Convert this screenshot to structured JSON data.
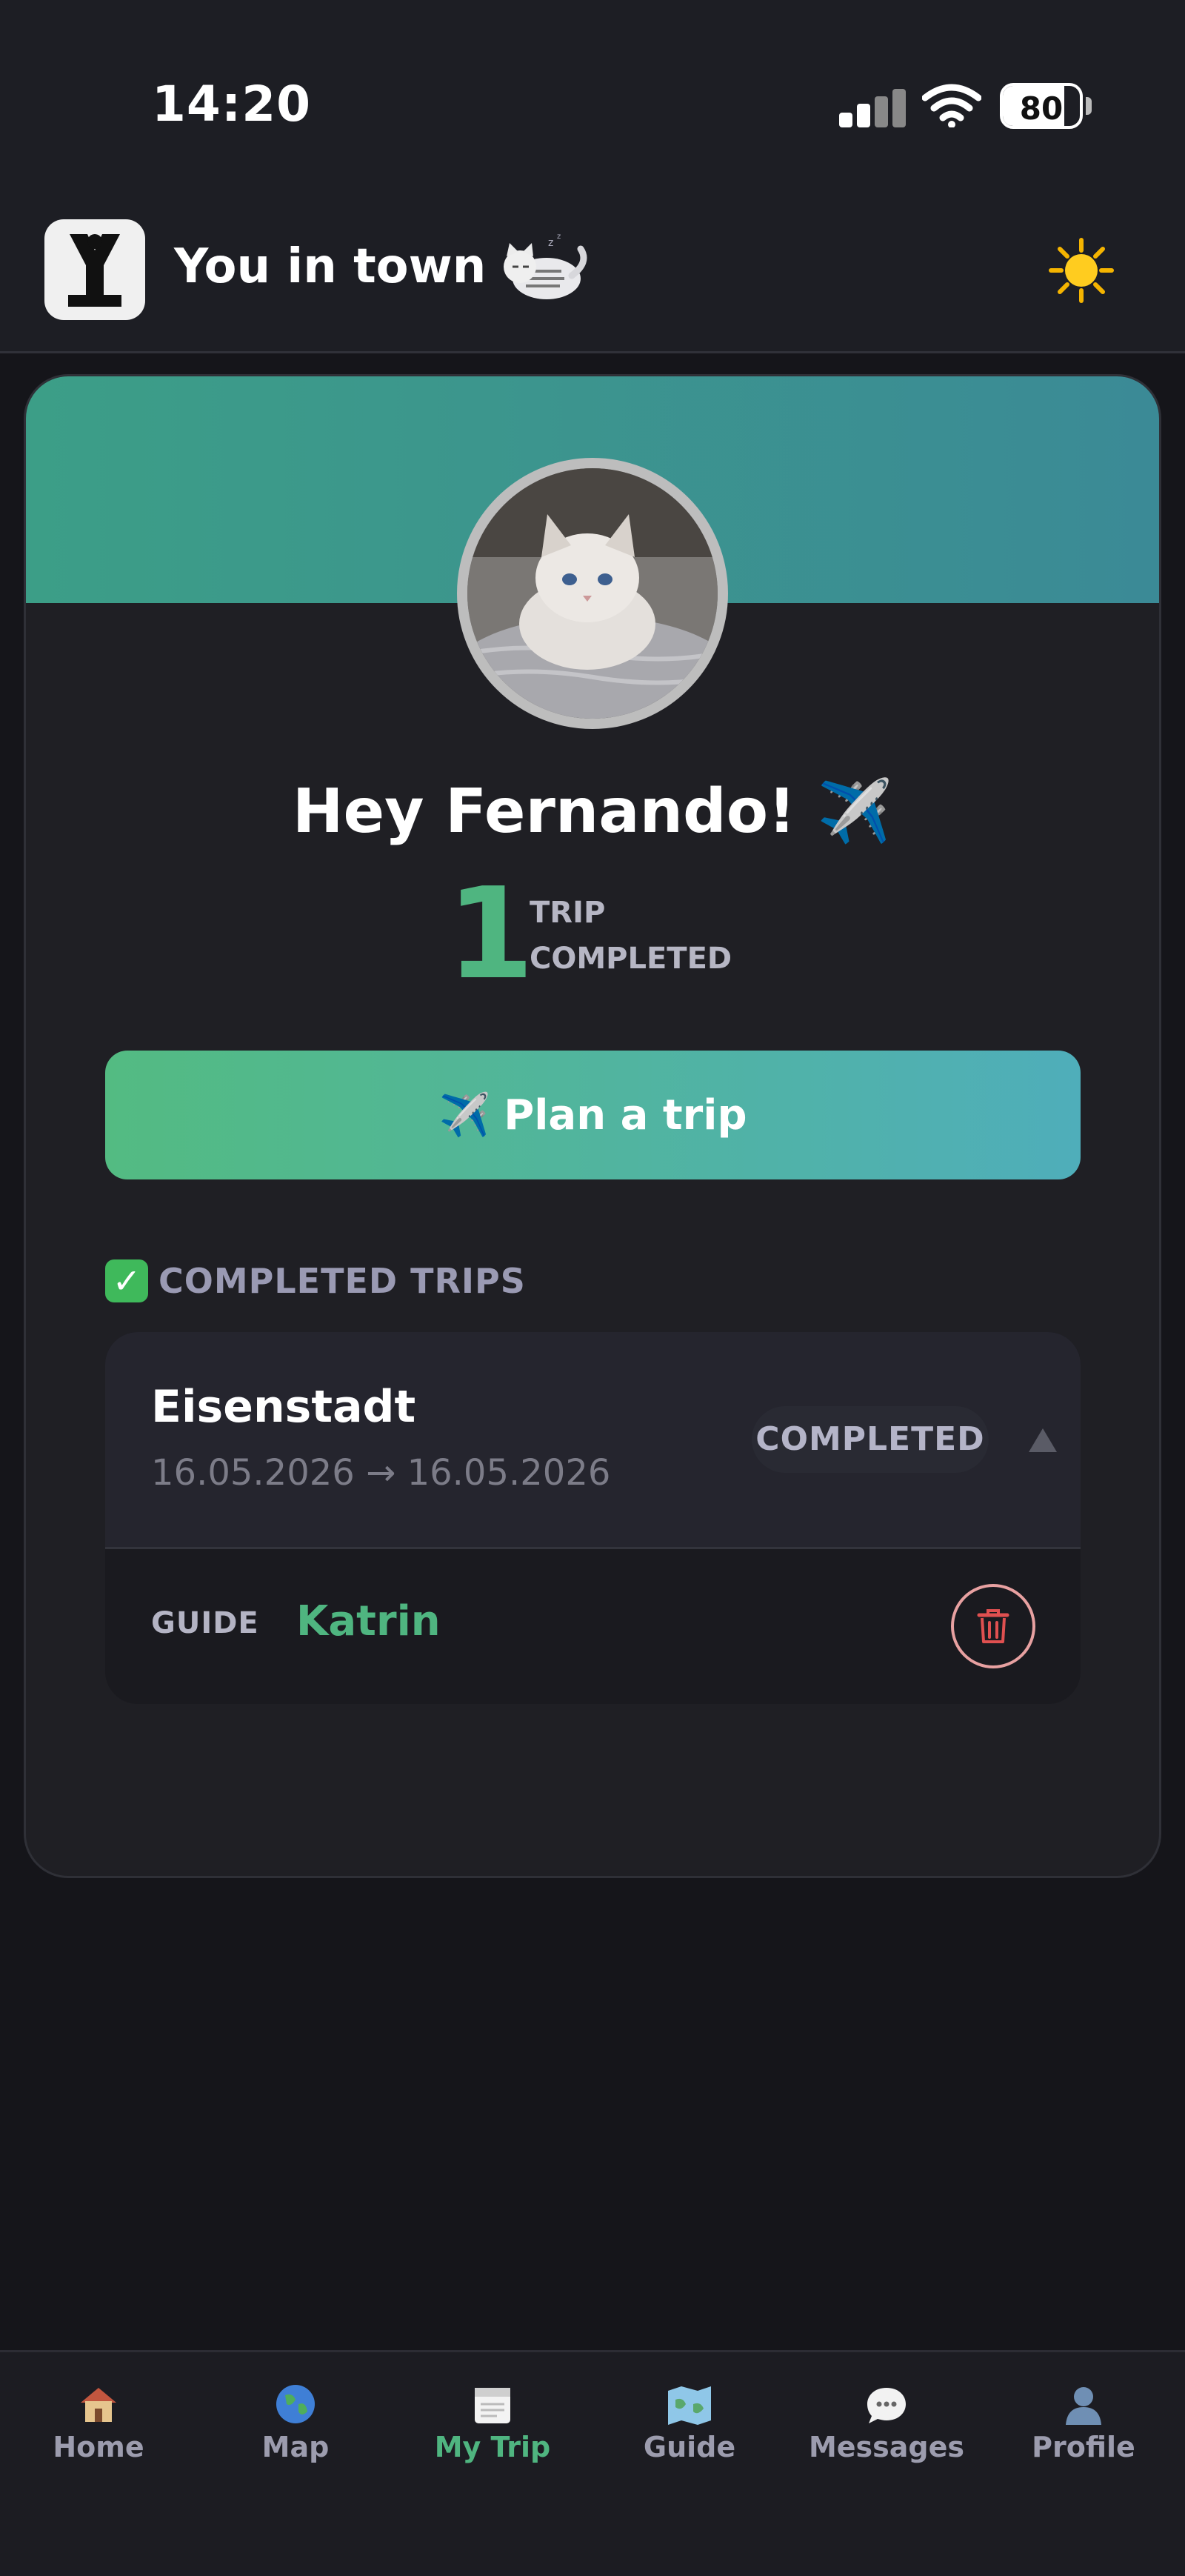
{
  "status_bar": {
    "time": "14:20",
    "battery": "80",
    "battery_level": 0.8
  },
  "header": {
    "app_title": "You in town",
    "logo_text": "Y"
  },
  "profile": {
    "greeting": "Hey Fernando! ✈️",
    "trips_completed_count": "1",
    "trips_completed_label_1": "TRIP",
    "trips_completed_label_2": "COMPLETED"
  },
  "plan_trip": {
    "label": "Plan a trip",
    "emoji": "✈️"
  },
  "completed_section": {
    "title": "COMPLETED TRIPS",
    "trips": [
      {
        "city": "Eisenstadt",
        "dates": "16.05.2026 → 16.05.2026",
        "status": "COMPLETED",
        "guide_label": "GUIDE",
        "guide_name": "Katrin"
      }
    ]
  },
  "tabbar": {
    "items": [
      {
        "label": "Home",
        "icon": "house-icon"
      },
      {
        "label": "Map",
        "icon": "globe-icon"
      },
      {
        "label": "My Trip",
        "icon": "calendar-icon",
        "active": true
      },
      {
        "label": "Guide",
        "icon": "map-icon"
      },
      {
        "label": "Messages",
        "icon": "chat-icon"
      },
      {
        "label": "Profile",
        "icon": "user-icon"
      }
    ]
  },
  "colors": {
    "accent": "#4fb580",
    "banner_start": "#3c9e87",
    "banner_end": "#3b8a96",
    "danger": "#e05050"
  }
}
